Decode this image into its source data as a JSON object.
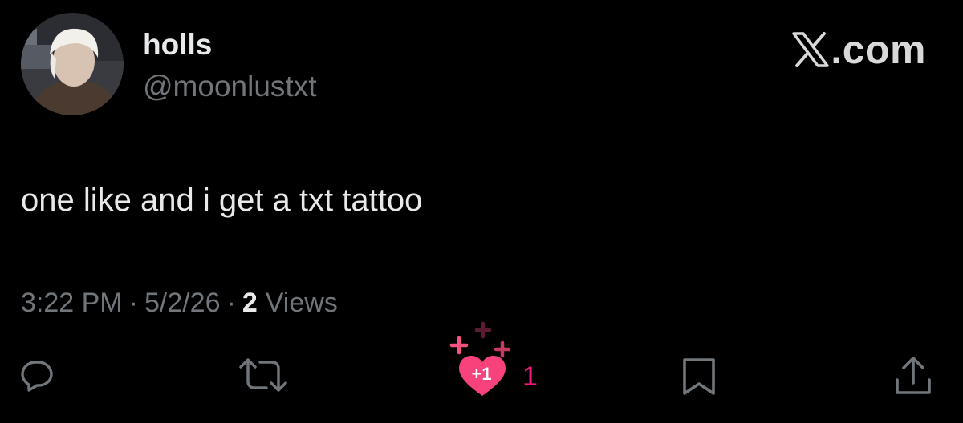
{
  "author": {
    "display_name": "holls",
    "handle": "@moonlustxt",
    "avatar_icon": "profile-photo"
  },
  "brand": {
    "text": ".com",
    "icon": "x-logo-icon"
  },
  "tweet": {
    "text": "one like and i get a txt tattoo",
    "time": "3:22 PM",
    "separator": "·",
    "date": "5/2/26",
    "views_count": "2",
    "views_label": "Views"
  },
  "actions": {
    "reply_icon": "reply-icon",
    "retweet_icon": "retweet-icon",
    "like_icon": "heart-icon",
    "like_badge": "+1",
    "like_count": "1",
    "bookmark_icon": "bookmark-icon",
    "share_icon": "share-icon"
  },
  "colors": {
    "background": "#000000",
    "primary_text": "#e7e9ea",
    "secondary_text": "#71767b",
    "like_pink": "#f91880"
  }
}
